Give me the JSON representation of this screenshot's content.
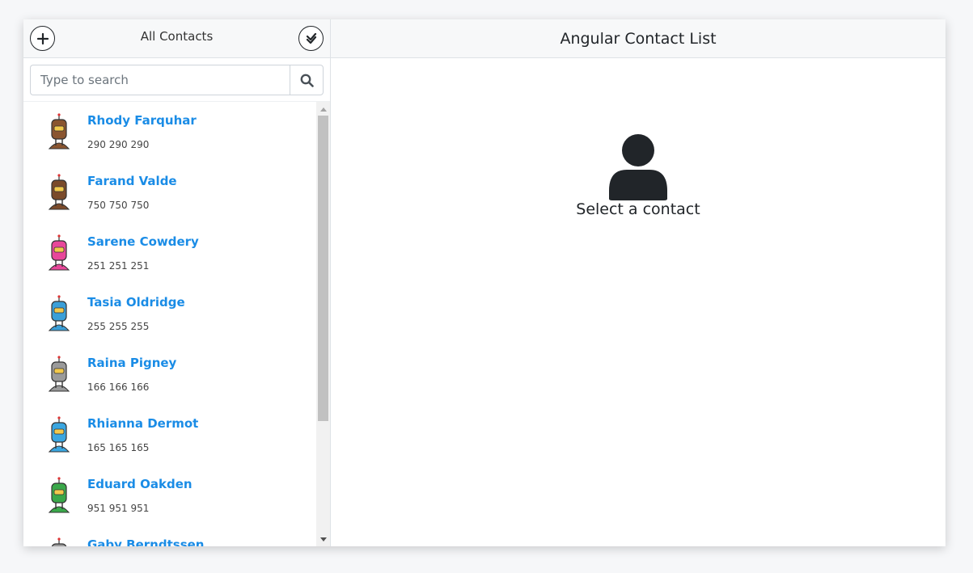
{
  "sidebar": {
    "title": "All Contacts",
    "add_icon": "plus-circle-icon",
    "select_icon": "double-check-circle-icon",
    "search": {
      "placeholder": "Type to search",
      "value": "",
      "icon": "search-icon"
    },
    "contacts": [
      {
        "name": "Rhody Farquhar",
        "phone": "290 290 290",
        "avatar_color": "#8a5530"
      },
      {
        "name": "Farand Valde",
        "phone": "750 750 750",
        "avatar_color": "#7a4a2a"
      },
      {
        "name": "Sarene Cowdery",
        "phone": "251 251 251",
        "avatar_color": "#e8479a"
      },
      {
        "name": "Tasia Oldridge",
        "phone": "255 255 255",
        "avatar_color": "#3a9fd8"
      },
      {
        "name": "Raina Pigney",
        "phone": "166 166 166",
        "avatar_color": "#9a9a9a"
      },
      {
        "name": "Rhianna Dermot",
        "phone": "165 165 165",
        "avatar_color": "#3aa6e0"
      },
      {
        "name": "Eduard Oakden",
        "phone": "951 951 951",
        "avatar_color": "#3aa84a"
      },
      {
        "name": "Gaby Berndtssen",
        "phone": "",
        "avatar_color": "#9a9a9a"
      }
    ]
  },
  "main": {
    "title": "Angular Contact List",
    "empty_icon": "user-silhouette-icon",
    "empty_text": "Select a contact"
  },
  "colors": {
    "accent": "#1a8ce6",
    "header_bg": "#f7f8f9",
    "border": "#dee2e6"
  }
}
